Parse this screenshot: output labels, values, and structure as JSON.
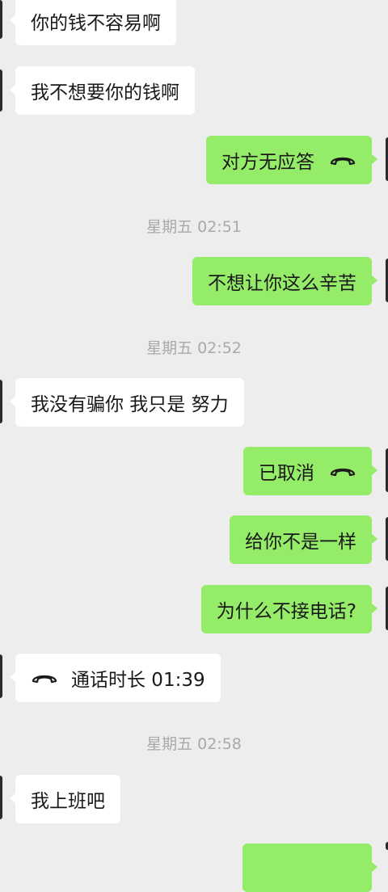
{
  "messages": [
    {
      "side": "in",
      "text": "你的钱不容易啊"
    },
    {
      "side": "in",
      "text": "我不想要你的钱啊"
    },
    {
      "side": "out",
      "text": "对方无应答",
      "icon": "phone-hangup-icon"
    },
    {
      "side": "time",
      "text": "星期五 02:51"
    },
    {
      "side": "out",
      "text": "不想让你这么辛苦"
    },
    {
      "side": "time",
      "text": "星期五 02:52"
    },
    {
      "side": "in",
      "text": "我没有骗你 我只是 努力"
    },
    {
      "side": "out",
      "text": "已取消",
      "icon": "phone-hangup-icon"
    },
    {
      "side": "out",
      "text": "给你不是一样"
    },
    {
      "side": "out",
      "text": "为什么不接电话?"
    },
    {
      "side": "in",
      "text": "通话时长 01:39",
      "icon": "phone-hangup-icon"
    },
    {
      "side": "time",
      "text": "星期五 02:58"
    },
    {
      "side": "in",
      "text": "我上班吧"
    }
  ],
  "colors": {
    "background": "#ededed",
    "incoming": "#ffffff",
    "outgoing": "#95ec69",
    "timestamp": "#a9a9a9"
  }
}
